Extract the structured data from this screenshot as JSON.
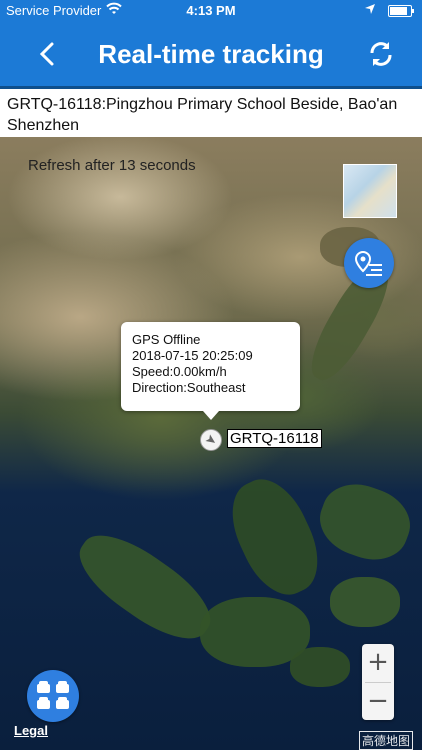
{
  "status_bar": {
    "carrier": "Service Provider",
    "time": "4:13 PM",
    "battery_level": 0.85
  },
  "navbar": {
    "title": "Real-time tracking",
    "back_icon": "chevron-left-icon",
    "refresh_icon": "refresh-icon"
  },
  "address": "GRTQ-16118:Pingzhou Primary School Beside, Bao'an Shenzhen",
  "map": {
    "refresh_text": "Refresh after 13 seconds",
    "popup": {
      "status": "GPS Offline",
      "datetime": "2018-07-15 20:25:09",
      "speed": "Speed:0.00km/h",
      "direction": "Direction:Southeast"
    },
    "vehicle_label": "GRTQ-16118",
    "zoom_in": "+",
    "zoom_out": "−",
    "legal": "Legal",
    "watermark": "高德地图"
  },
  "icons": {
    "route": "route-list-icon",
    "cars": "vehicles-icon"
  },
  "colors": {
    "primary": "#1c7ad6",
    "fab": "#2f7fe0"
  }
}
